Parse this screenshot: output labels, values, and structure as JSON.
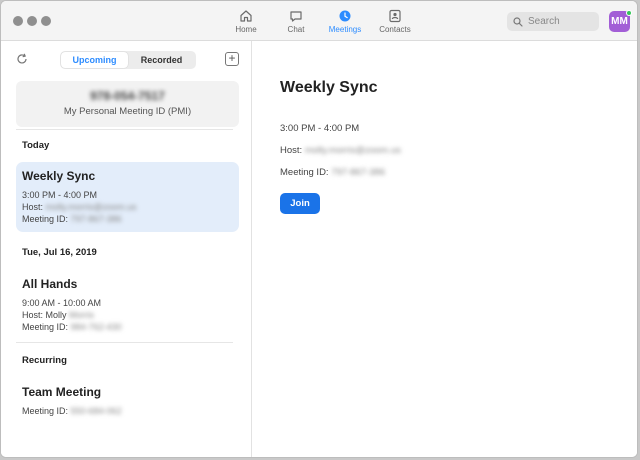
{
  "nav": {
    "home": "Home",
    "chat": "Chat",
    "meetings": "Meetings",
    "contacts": "Contacts"
  },
  "search": {
    "placeholder": "Search"
  },
  "user": {
    "initials": "MM"
  },
  "sidebar": {
    "tabs": {
      "upcoming": "Upcoming",
      "recorded": "Recorded"
    },
    "pmi": {
      "number": "978-054-7517",
      "label": "My Personal Meeting ID (PMI)"
    },
    "sections": {
      "today": "Today",
      "date": "Tue, Jul 16, 2019",
      "recurring": "Recurring"
    },
    "meetings": [
      {
        "title": "Weekly Sync",
        "time": "3:00 PM - 4:00 PM",
        "host_label": "Host:",
        "host": "molly.morris@zoom.us",
        "id_label": "Meeting ID:",
        "id": "797-867-386"
      },
      {
        "title": "All Hands",
        "time": "9:00 AM - 10:00 AM",
        "host_label": "Host: Molly",
        "host": "Morris",
        "id_label": "Meeting ID:",
        "id": "984-762-430"
      },
      {
        "title": "Team Meeting",
        "id_label": "Meeting ID:",
        "id": "550-684-062"
      }
    ]
  },
  "detail": {
    "title": "Weekly Sync",
    "time": "3:00 PM - 4:00 PM",
    "host_label": "Host:",
    "host": "molly.morris@zoom.us",
    "id_label": "Meeting ID:",
    "id": "797-867-386",
    "join_label": "Join"
  },
  "colors": {
    "accent": "#2d8cff",
    "join": "#1a73e8",
    "selected_bg": "#e3edfa",
    "avatar": "#a25ed6"
  }
}
